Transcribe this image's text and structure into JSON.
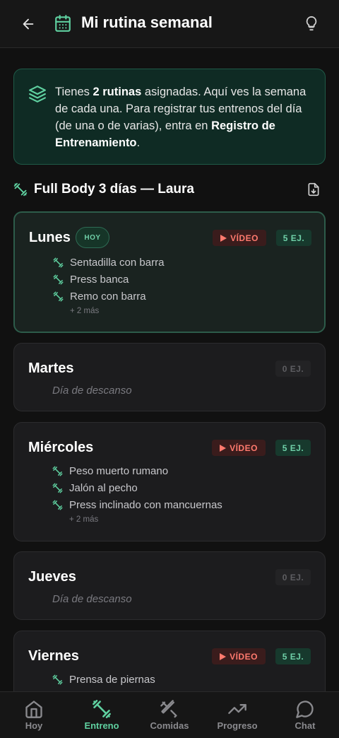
{
  "header": {
    "title": "Mi rutina semanal",
    "back_icon": "arrow-left-icon",
    "title_icon": "calendar-icon",
    "tip_icon": "lightbulb-icon"
  },
  "info": {
    "icon": "layers-icon",
    "text_a": "Tienes ",
    "count_bold": "2 rutinas",
    "text_b": " asignadas. Aquí ves la semana de cada una. Para registrar tus entrenos del día (de una o de varias), entra en ",
    "link_bold": "Registro de Entrenamiento",
    "text_c": "."
  },
  "routine": {
    "title": "Full Body 3 días — Laura",
    "download_icon": "file-download-icon"
  },
  "days": [
    {
      "name": "Lunes",
      "today_label": "HOY",
      "video_label": "VÍDEO",
      "count_label": "5 EJ.",
      "exercises": [
        "Sentadilla con barra",
        "Press banca",
        "Remo con barra"
      ],
      "more": "+ 2 más"
    },
    {
      "name": "Martes",
      "count_label": "0 EJ.",
      "rest": "Día de descanso"
    },
    {
      "name": "Miércoles",
      "video_label": "VÍDEO",
      "count_label": "5 EJ.",
      "exercises": [
        "Peso muerto rumano",
        "Jalón al pecho",
        "Press inclinado con mancuernas"
      ],
      "more": "+ 2 más"
    },
    {
      "name": "Jueves",
      "count_label": "0 EJ.",
      "rest": "Día de descanso"
    },
    {
      "name": "Viernes",
      "video_label": "VÍDEO",
      "count_label": "5 EJ.",
      "exercises": [
        "Prensa de piernas"
      ]
    }
  ],
  "nav": [
    {
      "label": "Hoy",
      "icon": "home-icon"
    },
    {
      "label": "Entreno",
      "icon": "dumbbell-icon",
      "active": true
    },
    {
      "label": "Comidas",
      "icon": "utensils-icon"
    },
    {
      "label": "Progreso",
      "icon": "trending-up-icon"
    },
    {
      "label": "Chat",
      "icon": "chat-bubble-icon"
    }
  ],
  "colors": {
    "accent": "#5fd0a0",
    "background": "#111111",
    "card": "#1c1c1e",
    "video_badge": "#ff7a6e"
  }
}
